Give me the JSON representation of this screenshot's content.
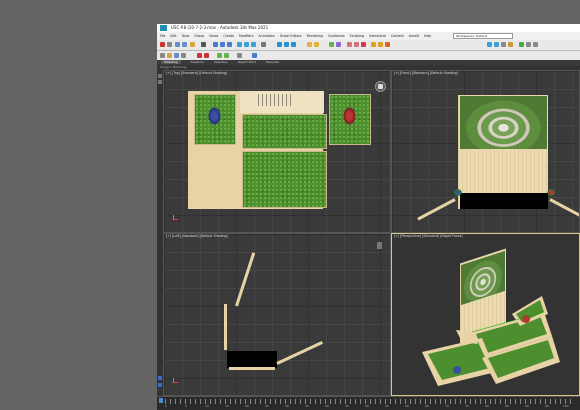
{
  "app": {
    "title": "USC P.8 (20-7-2-3.max - Autodesk 3ds Max 2021",
    "workspace": "Workspaces: Default"
  },
  "menu": [
    "File",
    "Edit",
    "Tools",
    "Group",
    "Views",
    "Create",
    "Modifiers",
    "Animation",
    "Graph Editors",
    "Rendering",
    "Customize",
    "Scripting",
    "Interactive",
    "Content",
    "Arnold",
    "Help"
  ],
  "ribbon": {
    "tabs": [
      "Modeling",
      "Freeform",
      "Selection",
      "Object Paint",
      "Populate"
    ],
    "active": "Modeling",
    "sub": "Polygon Modeling"
  },
  "viewports": {
    "top": {
      "label": "[+] [Top] [Standard] [Default Shading]"
    },
    "front": {
      "label": "[+] [Front] [Standard] [Default Shading]"
    },
    "left": {
      "label": "[+] [Left] [Standard] [Default Shading]"
    },
    "perspective": {
      "label": "[+] [Perspective] [Standard] [Edged Faces]"
    }
  },
  "viewcube": {
    "top": "TOP"
  },
  "timeline": {
    "frame_labels": [
      "0",
      "5",
      "10",
      "15",
      "20",
      "25",
      "30",
      "35",
      "40",
      "45",
      "50",
      "55",
      "60",
      "65",
      "70",
      "75",
      "80",
      "85",
      "90",
      "95",
      "100"
    ]
  },
  "colors": {
    "viewport_bg": "#3a3a3a",
    "grass": "#4a8f2b",
    "wood": "#e8d3a6",
    "active_border": "#d6c48a"
  }
}
